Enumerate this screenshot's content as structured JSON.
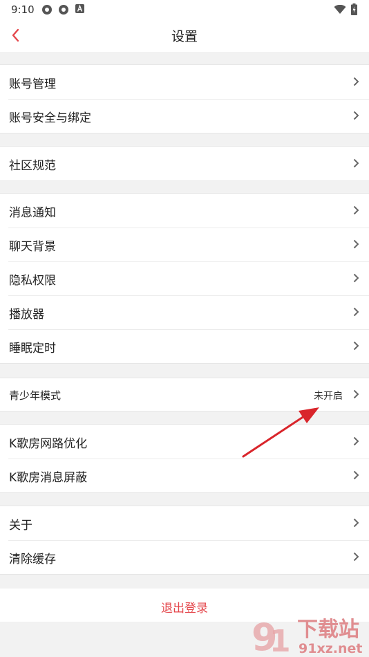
{
  "status_bar": {
    "time": "9:10"
  },
  "header": {
    "title": "设置"
  },
  "groups": [
    [
      {
        "label": "账号管理"
      },
      {
        "label": "账号安全与绑定"
      }
    ],
    [
      {
        "label": "社区规范"
      }
    ],
    [
      {
        "label": "消息通知"
      },
      {
        "label": "聊天背景"
      },
      {
        "label": "隐私权限"
      },
      {
        "label": "播放器"
      },
      {
        "label": "睡眠定时"
      }
    ],
    [
      {
        "label": "青少年模式",
        "value": "未开启"
      }
    ],
    [
      {
        "label": "K歌房网路优化"
      },
      {
        "label": "K歌房消息屏蔽"
      }
    ],
    [
      {
        "label": "关于"
      },
      {
        "label": "清除缓存"
      }
    ]
  ],
  "logout": {
    "label": "退出登录"
  },
  "watermark": {
    "text": "下载站",
    "domain": "91xz.net"
  },
  "colors": {
    "accent": "#e4464b",
    "annotation_arrow": "#d9252b"
  }
}
